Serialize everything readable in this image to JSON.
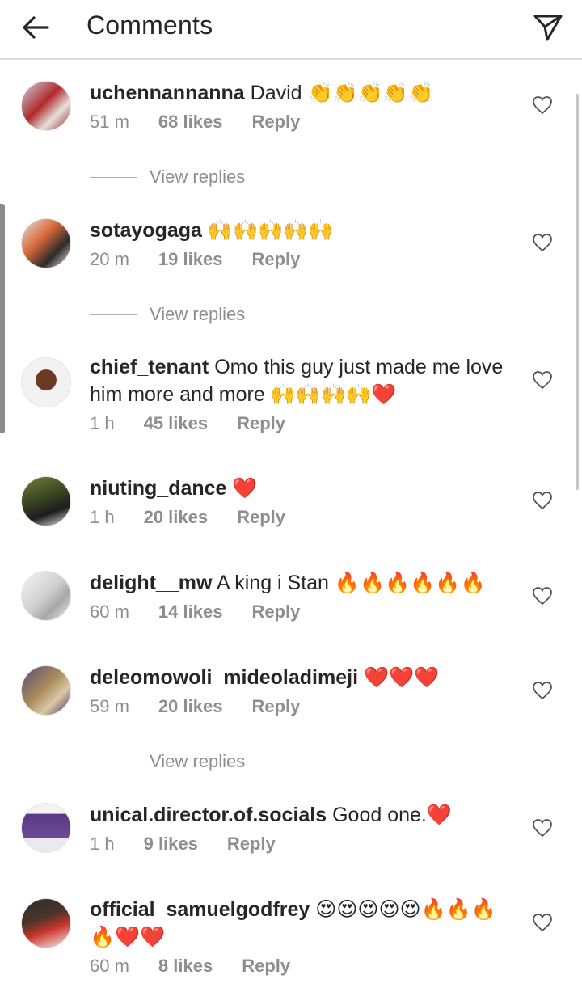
{
  "header": {
    "title": "Comments",
    "back_icon": "arrow-left-icon",
    "send_icon": "paper-plane-icon"
  },
  "comments": [
    {
      "username": "uchennannanna",
      "text": " David ",
      "emoji": "👏👏👏👏👏",
      "time": "51 m",
      "likes": "68 likes",
      "reply": "Reply",
      "view_replies": "View replies"
    },
    {
      "username": "sotayogaga",
      "text": " ",
      "emoji": "🙌🙌🙌🙌🙌",
      "time": "20 m",
      "likes": "19 likes",
      "reply": "Reply",
      "view_replies": "View replies"
    },
    {
      "username": "chief_tenant",
      "text": " Omo this guy just made me love him more and more ",
      "emoji": "🙌🙌🙌🙌❤️",
      "time": "1 h",
      "likes": "45 likes",
      "reply": "Reply"
    },
    {
      "username": "niuting_dance",
      "text": " ",
      "emoji": "❤️",
      "time": "1 h",
      "likes": "20 likes",
      "reply": "Reply"
    },
    {
      "username": "delight__mw",
      "text": " A king i Stan ",
      "emoji": "🔥🔥🔥🔥🔥🔥",
      "time": "60 m",
      "likes": "14 likes",
      "reply": "Reply"
    },
    {
      "username": "deleomowoli_mideoladimeji",
      "text": " ",
      "emoji": "❤️❤️❤️",
      "time": "59 m",
      "likes": "20 likes",
      "reply": "Reply",
      "view_replies": "View replies"
    },
    {
      "username": "unical.director.of.socials",
      "text": " Good one.",
      "emoji": "❤️",
      "time": "1 h",
      "likes": "9 likes",
      "reply": "Reply"
    },
    {
      "username": "official_samuelgodfrey",
      "text": " ",
      "emoji": "😍😍😍😍😍🔥🔥🔥🔥❤️❤️",
      "time": "60 m",
      "likes": "8 likes",
      "reply": "Reply"
    }
  ],
  "colors": {
    "text": "#262626",
    "muted": "#8e8e8e",
    "divider": "#dbdbdb",
    "heart_red": "#ed4956"
  }
}
